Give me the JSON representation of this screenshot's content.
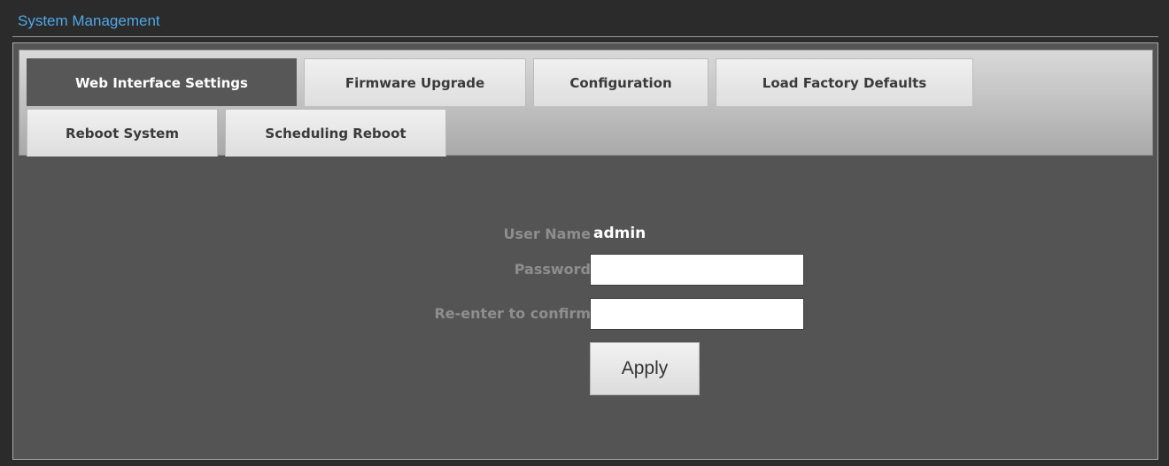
{
  "section": {
    "title": "System Management"
  },
  "tabs": [
    {
      "label": "Web Interface Settings",
      "active": true
    },
    {
      "label": "Firmware Upgrade",
      "active": false
    },
    {
      "label": "Configuration",
      "active": false
    },
    {
      "label": "Load Factory Defaults",
      "active": false
    },
    {
      "label": "Reboot System",
      "active": false
    },
    {
      "label": "Scheduling Reboot",
      "active": false
    }
  ],
  "form": {
    "user_name_label": "User Name",
    "user_name_value": "admin",
    "password_label": "Password",
    "password_value": "",
    "confirm_label": "Re-enter to confirm",
    "confirm_value": "",
    "apply_label": "Apply"
  },
  "colors": {
    "title": "#4fa8e8",
    "panel_bg": "#545454",
    "active_tab_bg": "#575757",
    "page_bg": "#2b2b2b"
  }
}
